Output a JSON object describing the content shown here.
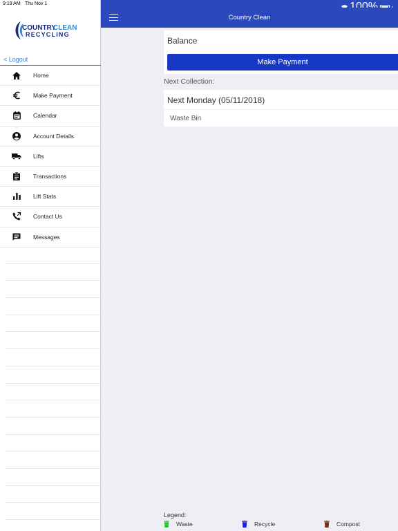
{
  "status": {
    "time": "9:19 AM",
    "date": "Thu Nov 1",
    "battery": "100%"
  },
  "sidebar": {
    "logo": {
      "line1a": "COUNTRY",
      "line1b": "CLEAN",
      "line2": "RECYCLING"
    },
    "logout": "< Logout",
    "items": [
      {
        "label": "Home",
        "icon": "home-icon"
      },
      {
        "label": "Make Payment",
        "icon": "euro-icon"
      },
      {
        "label": "Calendar",
        "icon": "calendar-icon"
      },
      {
        "label": "Account Details",
        "icon": "account-icon"
      },
      {
        "label": "Lifts",
        "icon": "truck-icon"
      },
      {
        "label": "Transactions",
        "icon": "clipboard-icon"
      },
      {
        "label": "Lift Stats",
        "icon": "bar-chart-icon"
      },
      {
        "label": "Contact Us",
        "icon": "phone-icon"
      },
      {
        "label": "Messages",
        "icon": "message-icon"
      }
    ]
  },
  "header": {
    "title": "Country Clean"
  },
  "main": {
    "balance_label": "Balance",
    "make_payment": "Make Payment",
    "next_collection_label": "Next Collection:",
    "next_collection_date": "Next Monday (05/11/2018)",
    "bin_type": "Waste Bin"
  },
  "legend": {
    "title": "Legend:",
    "items": [
      {
        "label": "Waste",
        "color": "#2fc43a"
      },
      {
        "label": "Recycle",
        "color": "#1d22d6"
      },
      {
        "label": "Compost",
        "color": "#6b3418"
      }
    ]
  },
  "colors": {
    "accent": "#2c48bd",
    "button": "#1738c3",
    "link": "#3b7cd8"
  }
}
